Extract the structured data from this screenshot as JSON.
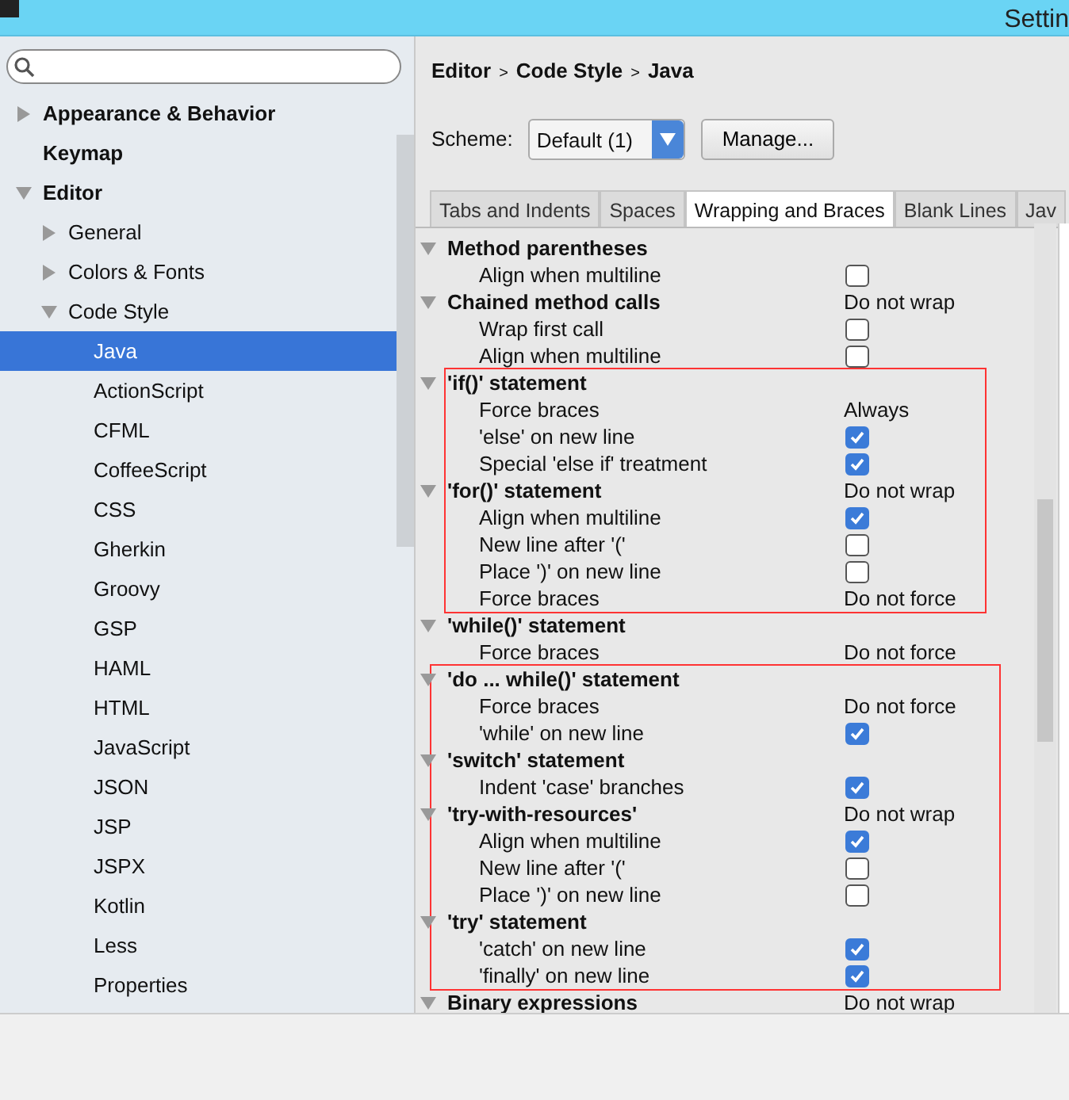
{
  "window": {
    "title": "Settin"
  },
  "sidebar": {
    "items": [
      {
        "label": "Appearance & Behavior",
        "bold": true,
        "expanded": false,
        "selected": false
      },
      {
        "label": "Keymap",
        "bold": true,
        "selected": false
      },
      {
        "label": "Editor",
        "bold": true,
        "expanded": true,
        "selected": false,
        "children": [
          {
            "label": "General",
            "expanded": false,
            "selected": false
          },
          {
            "label": "Colors & Fonts",
            "expanded": false,
            "selected": false
          },
          {
            "label": "Code Style",
            "expanded": true,
            "selected": false,
            "children": [
              {
                "label": "Java",
                "selected": true
              },
              {
                "label": "ActionScript",
                "selected": false
              },
              {
                "label": "CFML",
                "selected": false
              },
              {
                "label": "CoffeeScript",
                "selected": false
              },
              {
                "label": "CSS",
                "selected": false
              },
              {
                "label": "Gherkin",
                "selected": false
              },
              {
                "label": "Groovy",
                "selected": false
              },
              {
                "label": "GSP",
                "selected": false
              },
              {
                "label": "HAML",
                "selected": false
              },
              {
                "label": "HTML",
                "selected": false
              },
              {
                "label": "JavaScript",
                "selected": false
              },
              {
                "label": "JSON",
                "selected": false
              },
              {
                "label": "JSP",
                "selected": false
              },
              {
                "label": "JSPX",
                "selected": false
              },
              {
                "label": "Kotlin",
                "selected": false
              },
              {
                "label": "Less",
                "selected": false
              },
              {
                "label": "Properties",
                "selected": false
              }
            ]
          }
        ]
      }
    ]
  },
  "breadcrumb": [
    "Editor",
    "Code Style",
    "Java"
  ],
  "breadcrumb_separator": ">",
  "scheme": {
    "label": "Scheme:",
    "value": "Default (1)",
    "button": "Manage..."
  },
  "tabs": [
    {
      "label": "Tabs and Indents",
      "selected": false
    },
    {
      "label": "Spaces",
      "selected": false
    },
    {
      "label": "Wrapping and Braces",
      "selected": true
    },
    {
      "label": "Blank Lines",
      "selected": false
    },
    {
      "label": "Jav",
      "selected": false
    }
  ],
  "sections": [
    {
      "highlighted": false,
      "rows": [
        {
          "kind": "group",
          "label": "Method parentheses"
        },
        {
          "kind": "check",
          "label": "Align when multiline",
          "checked": false
        },
        {
          "kind": "group",
          "label": "Chained method calls",
          "value": "Do not wrap"
        },
        {
          "kind": "check",
          "label": "Wrap first call",
          "checked": false
        },
        {
          "kind": "check",
          "label": "Align when multiline",
          "checked": false
        }
      ]
    },
    {
      "highlighted": true,
      "rows": [
        {
          "kind": "group",
          "label": "'if()' statement"
        },
        {
          "kind": "option",
          "label": "Force braces",
          "value": "Always"
        },
        {
          "kind": "check",
          "label": "'else' on new line",
          "checked": true
        },
        {
          "kind": "check",
          "label": "Special 'else if' treatment",
          "checked": true
        },
        {
          "kind": "group",
          "label": "'for()' statement",
          "value": "Do not wrap"
        },
        {
          "kind": "check",
          "label": "Align when multiline",
          "checked": true
        },
        {
          "kind": "check",
          "label": "New line after '('",
          "checked": false
        },
        {
          "kind": "check",
          "label": "Place ')' on new line",
          "checked": false
        },
        {
          "kind": "option",
          "label": "Force braces",
          "value": "Do not force"
        }
      ]
    },
    {
      "highlighted": false,
      "rows": [
        {
          "kind": "group",
          "label": "'while()' statement"
        },
        {
          "kind": "option",
          "label": "Force braces",
          "value": "Do not force"
        }
      ]
    },
    {
      "highlighted": true,
      "rows": [
        {
          "kind": "group",
          "label": "'do ... while()' statement"
        },
        {
          "kind": "option",
          "label": "Force braces",
          "value": "Do not force"
        },
        {
          "kind": "check",
          "label": "'while' on new line",
          "checked": true
        },
        {
          "kind": "group",
          "label": "'switch' statement"
        },
        {
          "kind": "check",
          "label": "Indent 'case' branches",
          "checked": true
        },
        {
          "kind": "group",
          "label": "'try-with-resources'",
          "value": "Do not wrap"
        },
        {
          "kind": "check",
          "label": "Align when multiline",
          "checked": true
        },
        {
          "kind": "check",
          "label": "New line after '('",
          "checked": false
        },
        {
          "kind": "check",
          "label": "Place ')' on new line",
          "checked": false
        },
        {
          "kind": "group",
          "label": "'try' statement"
        },
        {
          "kind": "check",
          "label": "'catch' on new line",
          "checked": true
        },
        {
          "kind": "check",
          "label": "'finally' on new line",
          "checked": true
        }
      ]
    },
    {
      "highlighted": false,
      "rows": [
        {
          "kind": "group",
          "label": "Binary expressions",
          "value": "Do not wrap"
        }
      ]
    }
  ]
}
